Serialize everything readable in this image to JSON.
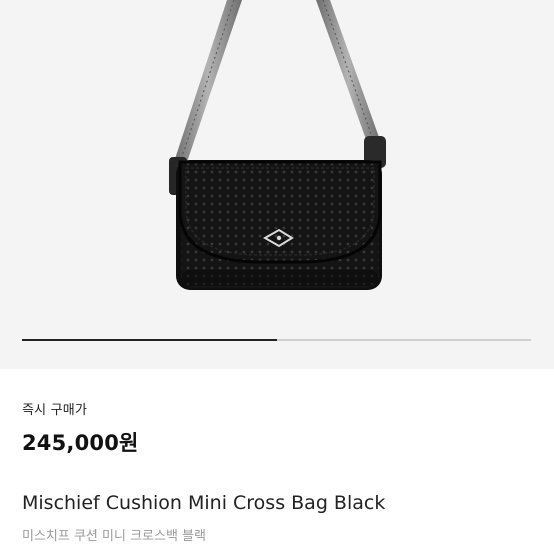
{
  "product": {
    "image_alt": "Mischief Cushion Mini Cross Bag Black product photo",
    "purchase_type": "즉시 구매가",
    "price": "245,000원",
    "name_en": "Mischief Cushion Mini Cross Bag Black",
    "name_ko": "미스치프 쿠션 미니 크로스백 블랙"
  },
  "gallery": {
    "progress": 0.5
  },
  "colors": {
    "background": "#f4f4f4",
    "bag": "#121212",
    "strap": "#8e8e8e"
  }
}
